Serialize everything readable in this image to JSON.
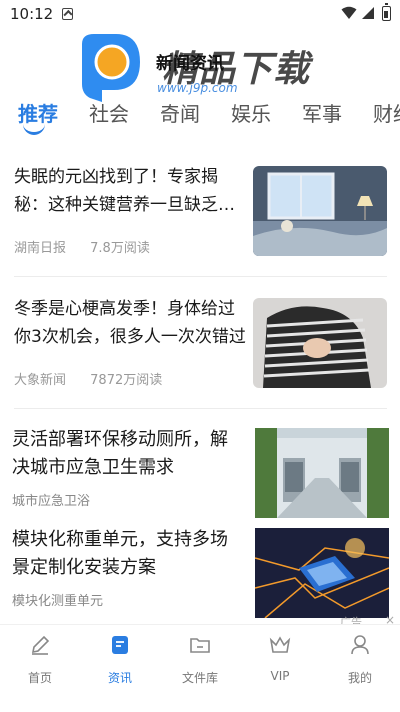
{
  "status_bar": {
    "time": "10:12"
  },
  "header": {
    "page_title": "新闻资讯",
    "brand_name": "精品下载",
    "brand_url": "www.j9p.com"
  },
  "tabs": [
    {
      "label": "推荐",
      "active": true
    },
    {
      "label": "社会"
    },
    {
      "label": "奇闻"
    },
    {
      "label": "娱乐"
    },
    {
      "label": "军事"
    },
    {
      "label": "财经"
    }
  ],
  "news": [
    {
      "title": "失眠的元凶找到了！专家揭秘：这种关键营养一旦缺乏…",
      "source": "湖南日报",
      "reads": "7.8万阅读"
    },
    {
      "title": "冬季是心梗高发季！身体给过你3次机会，很多人一次次错过",
      "source": "大象新闻",
      "reads": "7872万阅读"
    }
  ],
  "ads": [
    {
      "title": "灵活部署环保移动厕所，解决城市应急卫生需求",
      "source": "城市应急卫浴"
    },
    {
      "title": "模块化称重单元，支持多场景定制化安装方案",
      "source": "模块化测重单元"
    }
  ],
  "ad_label": "广告",
  "ad_close": "×",
  "bottom_nav": [
    {
      "label": "首页",
      "icon": "pencil-icon"
    },
    {
      "label": "资讯",
      "icon": "news-icon",
      "active": true
    },
    {
      "label": "文件库",
      "icon": "folder-icon"
    },
    {
      "label": "VIP",
      "icon": "crown-icon"
    },
    {
      "label": "我的",
      "icon": "user-icon"
    }
  ],
  "colors": {
    "accent": "#2a7de1",
    "logo_orange": "#f5a623",
    "logo_blue": "#2f8cf0"
  }
}
